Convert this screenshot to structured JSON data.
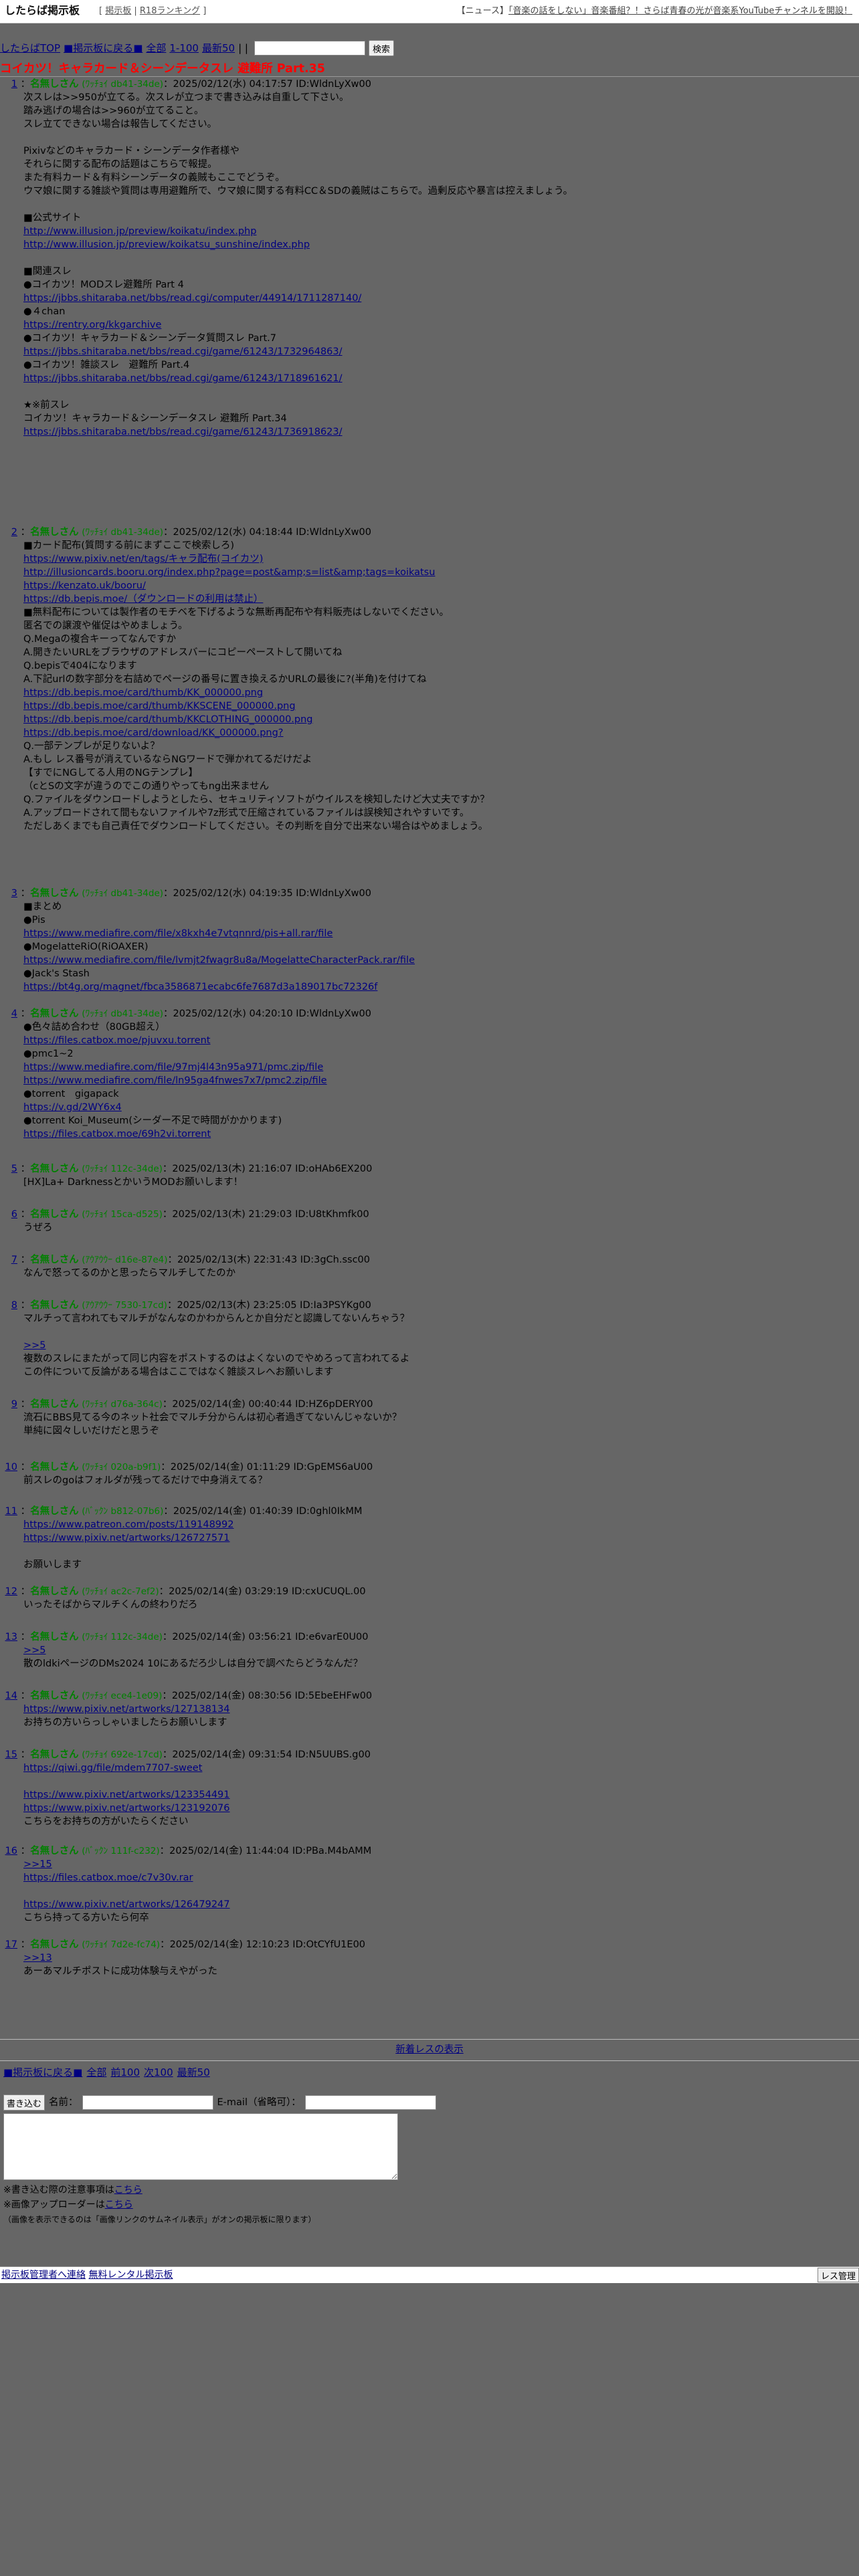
{
  "header": {
    "logo": "したらば掲示板",
    "nav_links": [
      "掲示板",
      "R18ランキング"
    ],
    "news_label": "【ニュース】",
    "news_text": "「音楽の話をしない」音楽番組？！さらば青春の光が音楽系YouTubeチャンネルを開設！"
  },
  "nav": {
    "top": "したらばTOP",
    "back": "■掲示板に戻る■",
    "all": "全部",
    "range": "1-100",
    "latest": "最新50",
    "separator": "| |",
    "search_placeholder": "",
    "search_button": "検索"
  },
  "thread_title": "コイカツ！キャラカード＆シーンデータスレ 避難所 Part.35",
  "posts": [
    {
      "num": "1",
      "name": "名無しさん",
      "trip": "(ﾜｯﾁｮｲ db41-34de)",
      "meta": "：2025/02/12(水) 04:17:57 ID:WldnLyXw00",
      "lines": [
        "次スレは>>950が立てる。次スレが立つまで書き込みは自重して下さい。",
        "踏み逃げの場合は>>960が立てること。",
        "スレ立てできない場合は報告してください。",
        "",
        "Pixivなどのキャラカード・シーンデータ作者様や",
        "それらに関する配布の話題はこちらで報提。",
        "また有料カード＆有料シーンデータの義賊もここでどうぞ。",
        "ウマ娘に関する雑談や質問は専用避難所で、ウマ娘に関する有料CC＆SDの義賊はこちらで。過剰反応や暴言は控えましょう。",
        "",
        "■公式サイト",
        "http://www.illusion.jp/preview/koikatu/index.php",
        "http://www.illusion.jp/preview/koikatsu_sunshine/index.php",
        "",
        "■関連スレ",
        "●コイカツ！MODスレ避難所 Part 4",
        "https://jbbs.shitaraba.net/bbs/read.cgi/computer/44914/1711287140/",
        "●４chan",
        "https://rentry.org/kkgarchive",
        "●コイカツ！キャラカード＆シーンデータ質問スレ Part.7",
        "https://jbbs.shitaraba.net/bbs/read.cgi/game/61243/1732964863/",
        "●コイカツ！雑談スレ　避難所 Part.4",
        "https://jbbs.shitaraba.net/bbs/read.cgi/game/61243/1718961621/",
        "",
        "★※前スレ",
        "コイカツ！キャラカード＆シーンデータスレ 避難所 Part.34",
        "https://jbbs.shitaraba.net/bbs/read.cgi/game/61243/1736918623/"
      ]
    },
    {
      "num": "2",
      "name": "名無しさん",
      "trip": "(ﾜｯﾁｮｲ db41-34de)",
      "meta": "：2025/02/12(水) 04:18:44 ID:WldnLyXw00",
      "lines": [
        "■カード配布(質問する前にまずここで検索しろ)",
        "https://www.pixiv.net/en/tags/キャラ配布(コイカツ)",
        "http://illusioncards.booru.org/index.php?page=post&amp;s=list&amp;tags=koikatsu",
        "https://kenzato.uk/booru/",
        "https://db.bepis.moe/（ダウンロードの利用は禁止）",
        "■無料配布については製作者のモチベを下げるような無断再配布や有料販売はしないでください。",
        "匿名での譲渡や催促はやめましょう。",
        "Q.Megaの複合キーってなんですか",
        "A.開きたいURLをブラウザのアドレスバーにコピーペーストして開いてね",
        "Q.bepisで404になります",
        "A.下記urlの数字部分を右詰めでページの番号に置き換えるかURLの最後に?(半角)を付けてね",
        "https://db.bepis.moe/card/thumb/KK_000000.png",
        "https://db.bepis.moe/card/thumb/KKSCENE_000000.png",
        "https://db.bepis.moe/card/thumb/KKCLOTHING_000000.png",
        "https://db.bepis.moe/card/download/KK_000000.png?",
        "Q.一部テンプレが足りないよ？",
        "A.もし レス番号が消えているならNGワードで弾かれてるだけだよ",
        "【すでにNGしてる人用のNGテンプレ】",
        "（cとSの文字が違うのでこの通りやってもng出来ません",
        "Q.ファイルをダウンロードしようとしたら、セキュリティソフトがウイルスを検知したけど大丈夫ですか？",
        "A.アップロードされて間もないファイルや7z形式で圧縮されているファイルは誤検知されやすいです。",
        "ただしあくまでも自己責任でダウンロードしてください。その判断を自分で出来ない場合はやめましょう。"
      ]
    },
    {
      "num": "3",
      "name": "名無しさん",
      "trip": "(ﾜｯﾁｮｲ db41-34de)",
      "meta": "：2025/02/12(水) 04:19:35 ID:WldnLyXw00",
      "lines": [
        "■まとめ",
        "●Pis",
        "https://www.mediafire.com/file/x8kxh4e7vtqnnrd/pis+all.rar/file",
        "●MogelatteRiO(RiOAXER)",
        "https://www.mediafire.com/file/lvmjt2fwagr8u8a/MogelatteCharacterPack.rar/file",
        "●Jack's Stash",
        "https://bt4g.org/magnet/fbca3586871ecabc6fe7687d3a189017bc72326f"
      ]
    },
    {
      "num": "4",
      "name": "名無しさん",
      "trip": "(ﾜｯﾁｮｲ db41-34de)",
      "meta": "：2025/02/12(水) 04:20:10 ID:WldnLyXw00",
      "lines": [
        "●色々詰め合わせ（80GB超え）",
        "https://files.catbox.moe/pjuvxu.torrent",
        "●pmc1~2",
        "https://www.mediafire.com/file/97mj4l43n95a971/pmc.zip/file",
        "https://www.mediafire.com/file/ln95ga4fnwes7x7/pmc2.zip/file",
        "●torrent　gigapack",
        "https://v.gd/2WY6x4",
        "●torrent Koi_Museum(シーダー不足で時間がかかります)",
        "https://files.catbox.moe/69h2vi.torrent"
      ]
    },
    {
      "num": "5",
      "name": "名無しさん",
      "trip": "(ﾜｯﾁｮｲ 112c-34de)",
      "meta": "：2025/02/13(木) 21:16:07 ID:oHAb6EX200",
      "lines": [
        "[HX]La+ DarknessとかいうMODお願いします！"
      ]
    },
    {
      "num": "6",
      "name": "名無しさん",
      "trip": "(ﾜｯﾁｮｲ 15ca-d525)",
      "meta": "：2025/02/13(木) 21:29:03 ID:U8tKhmfk00",
      "lines": [
        "うぜろ"
      ]
    },
    {
      "num": "7",
      "name": "名無しさん",
      "trip": "(ｱｳｱｳｳｰ d16e-87e4)",
      "meta": "：2025/02/13(木) 22:31:43 ID:3gCh.ssc00",
      "lines": [
        "なんで怒ってるのかと思ったらマルチしてたのか"
      ]
    },
    {
      "num": "8",
      "name": "名無しさん",
      "trip": "(ｱｳｱｳｳｰ 7530-17cd)",
      "meta": "：2025/02/13(木) 23:25:05 ID:Ia3PSYKg00",
      "lines": [
        "マルチって言われてもマルチがなんなのかわからんとか自分だと認識してないんちゃう？",
        "",
        ">>5",
        "複数のスレにまたがって同じ内容をポストするのはよくないのでやめろって言われてるよ",
        "この件について反論がある場合はここではなく雑談スレへお願いします"
      ]
    },
    {
      "num": "9",
      "name": "名無しさん",
      "trip": "(ﾜｯﾁｮｲ d76a-364c)",
      "meta": "：2025/02/14(金) 00:40:44 ID:HZ6pDERY00",
      "lines": [
        "流石にBBS見てる今のネット社会でマルチ分からんは初心者過ぎてないんじゃないか？",
        "単純に図々しいだけだと思うぞ"
      ]
    },
    {
      "num": "10",
      "name": "名無しさん",
      "trip": "(ﾜｯﾁｮｲ 020a-b9f1)",
      "meta": "：2025/02/14(金) 01:11:29 ID:GpEMS6aU00",
      "lines": [
        "前スレのgoはフォルダが残ってるだけで中身消えてる？"
      ]
    },
    {
      "num": "11",
      "name": "名無しさん",
      "trip": "(ﾊﾞｯｸﾝ b812-07b6)",
      "meta": "：2025/02/14(金) 01:40:39 ID:0ghl0IkMM",
      "lines": [
        "https://www.patreon.com/posts/119148992",
        "https://www.pixiv.net/artworks/126727571",
        "",
        "お願いします"
      ]
    },
    {
      "num": "12",
      "name": "名無しさん",
      "trip": "(ﾜｯﾁｮｲ ac2c-7ef2)",
      "meta": "：2025/02/14(金) 03:29:19 ID:cxUCUQL.00",
      "lines": [
        "いったそばからマルチくんの終わりだろ"
      ]
    },
    {
      "num": "13",
      "name": "名無しさん",
      "trip": "(ﾜｯﾁｮｲ 112c-34de)",
      "meta": "：2025/02/14(金) 03:56:21 ID:e6varE0U00",
      "lines": [
        ">>5",
        "散のldkiページのDMs2024 10にあるだろ少しは自分で調べたらどうなんだ？"
      ]
    },
    {
      "num": "14",
      "name": "名無しさん",
      "trip": "(ﾜｯﾁｮｲ ece4-1e09)",
      "meta": "：2025/02/14(金) 08:30:56 ID:5EbeEHFw00",
      "lines": [
        "https://www.pixiv.net/artworks/127138134",
        "お持ちの方いらっしゃいましたらお願いします"
      ]
    },
    {
      "num": "15",
      "name": "名無しさん",
      "trip": "(ﾜｯﾁｮｲ 692e-17cd)",
      "meta": "：2025/02/14(金) 09:31:54 ID:N5UUBS.g00",
      "lines": [
        "https://qiwi.gg/file/mdem7707-sweet",
        "",
        "https://www.pixiv.net/artworks/123354491",
        "https://www.pixiv.net/artworks/123192076",
        "こちらをお持ちの方がいたらください"
      ]
    },
    {
      "num": "16",
      "name": "名無しさん",
      "trip": "(ﾊﾞｯｸﾝ 111f-c232)",
      "meta": "：2025/02/14(金) 11:44:04 ID:PBa.M4bAMM",
      "lines": [
        ">>15",
        "https://files.catbox.moe/c7v30v.rar",
        "",
        "https://www.pixiv.net/artworks/126479247",
        "こちら持ってる方いたら何卒"
      ]
    },
    {
      "num": "17",
      "name": "名無しさん",
      "trip": "(ﾜｯﾁｮｲ 7d2e-fc74)",
      "meta": "：2025/02/14(金) 12:10:23 ID:OtCYfU1E00",
      "lines": [
        ">>13",
        "あーあマルチポストに成功体験与えやがった"
      ]
    }
  ],
  "footer": {
    "new_res": "新着レスの表示",
    "back": "■掲示板に戻る■",
    "all": "全部",
    "prev": "前100",
    "next": "次100",
    "latest": "最新50",
    "submit_button": "書き込む",
    "name_label": "名前：",
    "email_label": "E-mail（省略可）：",
    "note1_prefix": "※書き込む際の注意事項は",
    "note1_link": "こちら",
    "note2_prefix": "※画像アップローダーは",
    "note2_link": "こちら",
    "note3": "（画像を表示できるのは「画像リンクのサムネイル表示」がオンの掲示板に限ります）",
    "contact_link": "掲示板管理者へ連絡",
    "free_link": "無料レンタル掲示板",
    "manage_button": "レス管理"
  },
  "colors": {
    "title_red": "#ff0000",
    "name_green": "#008000",
    "link_blue": "#000080",
    "page_background": "#666666"
  }
}
